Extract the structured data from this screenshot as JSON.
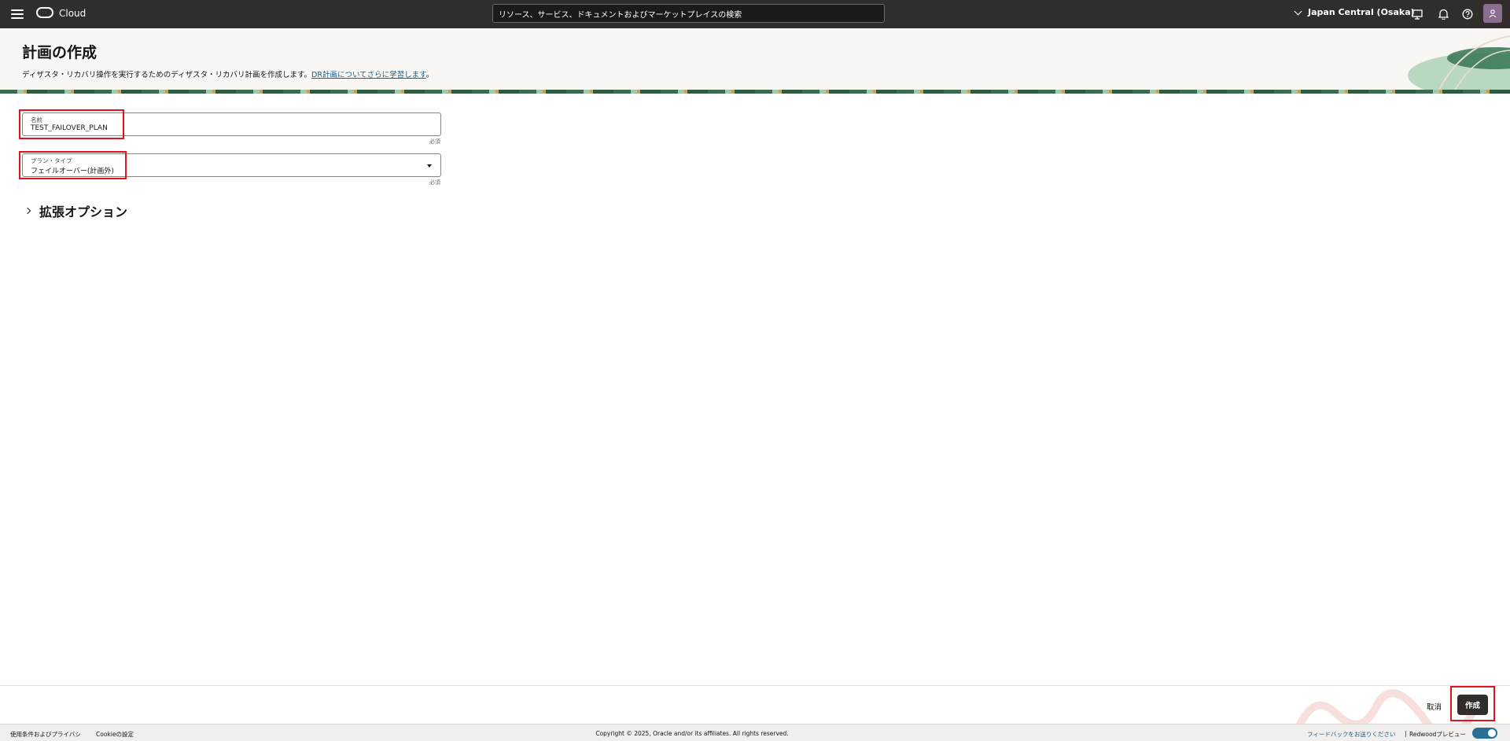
{
  "topbar": {
    "brand": "Cloud",
    "search_placeholder": "リソース、サービス、ドキュメントおよびマーケットプレイスの検索",
    "region": "Japan Central (Osaka)"
  },
  "header": {
    "title": "計画の作成",
    "description": "ディザスタ・リカバリ操作を実行するためのディザスタ・リカバリ計画を作成します。",
    "link": "DR計画についてさらに学習します",
    "description_end": "。"
  },
  "form": {
    "name": {
      "label": "名前",
      "value": "TEST_FAILOVER_PLAN",
      "required": "必須"
    },
    "plan_type": {
      "label": "プラン・タイプ",
      "value": "フェイルオーバー(計画外)",
      "required": "必須"
    },
    "advanced": "拡張オプション"
  },
  "actions": {
    "cancel": "取消",
    "create": "作成"
  },
  "footer": {
    "terms": "使用条件およびプライバシ",
    "cookies": "Cookieの設定",
    "copyright": "Copyright © 2025, Oracle and/or its affiliates. All rights reserved.",
    "feedback": "フィードバックをお送りください",
    "separator": "|",
    "redwood": "Redwoodプレビュー"
  },
  "colors": {
    "topbar": "#312d2a",
    "highlight": "#e0141e",
    "link": "#1a5c8a",
    "toggle": "#2a6f93"
  }
}
